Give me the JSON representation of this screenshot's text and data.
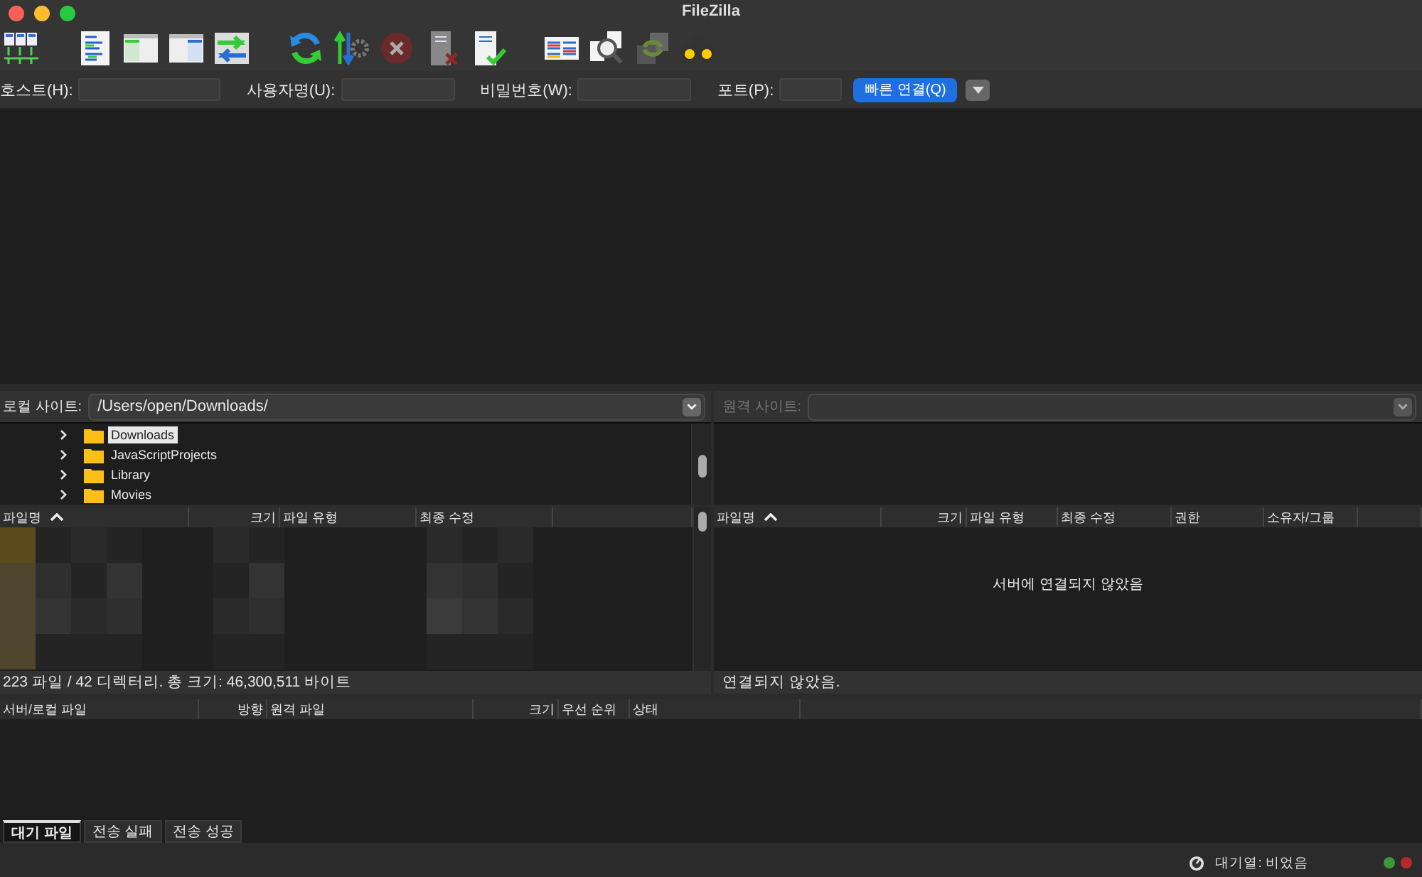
{
  "window": {
    "title": "FileZilla"
  },
  "quickconnect": {
    "fields": [
      {
        "label": "호스트(H):"
      },
      {
        "label": "사용자명(U):"
      },
      {
        "label": "비밀번호(W):"
      },
      {
        "label": "포트(P):"
      }
    ],
    "button": "빠른 연결(Q)"
  },
  "local": {
    "label": "로컬 사이트:",
    "path": "/Users/open/Downloads/",
    "tree": [
      {
        "name": "Downloads",
        "selected": true
      },
      {
        "name": "JavaScriptProjects",
        "selected": false
      },
      {
        "name": "Library",
        "selected": false
      },
      {
        "name": "Movies",
        "selected": false
      }
    ],
    "columns": [
      {
        "label": "파일명",
        "sorted": true
      },
      {
        "label": "크기",
        "sorted": false
      },
      {
        "label": "파일 유형",
        "sorted": false
      },
      {
        "label": "최종 수정",
        "sorted": false
      }
    ],
    "status": "223 파일 / 42 디렉터리. 총 크기: 46,300,511 바이트"
  },
  "remote": {
    "label": "원격 사이트:",
    "columns": [
      {
        "label": "파일명",
        "sorted": true
      },
      {
        "label": "크기",
        "sorted": false
      },
      {
        "label": "파일 유형",
        "sorted": false
      },
      {
        "label": "최종 수정",
        "sorted": false
      },
      {
        "label": "권한",
        "sorted": false
      },
      {
        "label": "소유자/그룹",
        "sorted": false
      }
    ],
    "message": "서버에 연결되지 않았음",
    "status": "연결되지 않았음."
  },
  "queue": {
    "columns": [
      {
        "label": "서버/로컬 파일"
      },
      {
        "label": "방향"
      },
      {
        "label": "원격 파일"
      },
      {
        "label": "크기"
      },
      {
        "label": "우선 순위"
      },
      {
        "label": "상태"
      }
    ],
    "tabs": [
      {
        "label": "대기 파일",
        "selected": true
      },
      {
        "label": "전송 실패",
        "selected": false
      },
      {
        "label": "전송 성공",
        "selected": false
      }
    ]
  },
  "status_bar": {
    "queue": "대기열: 비었음"
  }
}
